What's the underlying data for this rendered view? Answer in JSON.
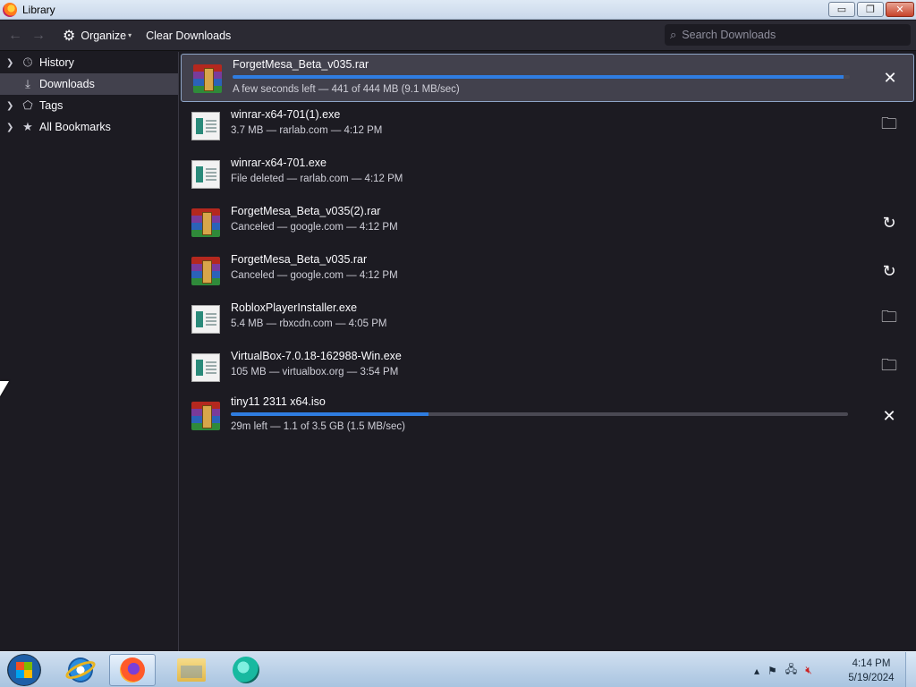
{
  "window": {
    "title": "Library"
  },
  "window_buttons": {
    "minimize": "▭",
    "maximize": "❐",
    "close": "✕"
  },
  "toolbar": {
    "back_icon": "←",
    "forward_icon": "→",
    "organize_label": "Organize",
    "clear_label": "Clear Downloads",
    "search_placeholder": "Search Downloads"
  },
  "sidebar": {
    "items": [
      {
        "label": "History",
        "icon": "clock-icon",
        "expandable": true
      },
      {
        "label": "Downloads",
        "icon": "download-icon",
        "expandable": false,
        "selected": true
      },
      {
        "label": "Tags",
        "icon": "tag-icon",
        "expandable": true
      },
      {
        "label": "All Bookmarks",
        "icon": "star-icon",
        "expandable": true
      }
    ]
  },
  "downloads": [
    {
      "name": "ForgetMesa_Beta_v035.rar",
      "status": "A few seconds left — 441 of 444 MB (9.1 MB/sec)",
      "type": "rar",
      "in_progress": true,
      "progress": 0.99,
      "action": "cancel",
      "selected": true
    },
    {
      "name": "winrar-x64-701(1).exe",
      "status": "3.7 MB — rarlab.com — 4:12 PM",
      "type": "exe",
      "action": "show-folder"
    },
    {
      "name": "winrar-x64-701.exe",
      "status": "File deleted — rarlab.com — 4:12 PM",
      "type": "exe",
      "action": "none"
    },
    {
      "name": "ForgetMesa_Beta_v035(2).rar",
      "status": "Canceled — google.com — 4:12 PM",
      "type": "rar",
      "action": "retry"
    },
    {
      "name": "ForgetMesa_Beta_v035.rar",
      "status": "Canceled — google.com — 4:12 PM",
      "type": "rar",
      "action": "retry"
    },
    {
      "name": "RobloxPlayerInstaller.exe",
      "status": "5.4 MB — rbxcdn.com — 4:05 PM",
      "type": "exe",
      "action": "show-folder"
    },
    {
      "name": "VirtualBox-7.0.18-162988-Win.exe",
      "status": "105 MB — virtualbox.org — 3:54 PM",
      "type": "exe",
      "action": "show-folder"
    },
    {
      "name": "tiny11 2311 x64.iso",
      "status": "29m left — 1.1 of 3.5 GB (1.5 MB/sec)",
      "type": "rar",
      "in_progress": true,
      "progress": 0.32,
      "action": "cancel"
    }
  ],
  "taskbar": {
    "apps": [
      "internet-explorer",
      "firefox",
      "file-explorer",
      "teal-app"
    ],
    "active_app": "firefox",
    "clock_time": "4:14 PM",
    "clock_date": "5/19/2024"
  },
  "colors": {
    "accent": "#2f7de1",
    "background": "#1c1b22",
    "selected": "#42414d"
  }
}
